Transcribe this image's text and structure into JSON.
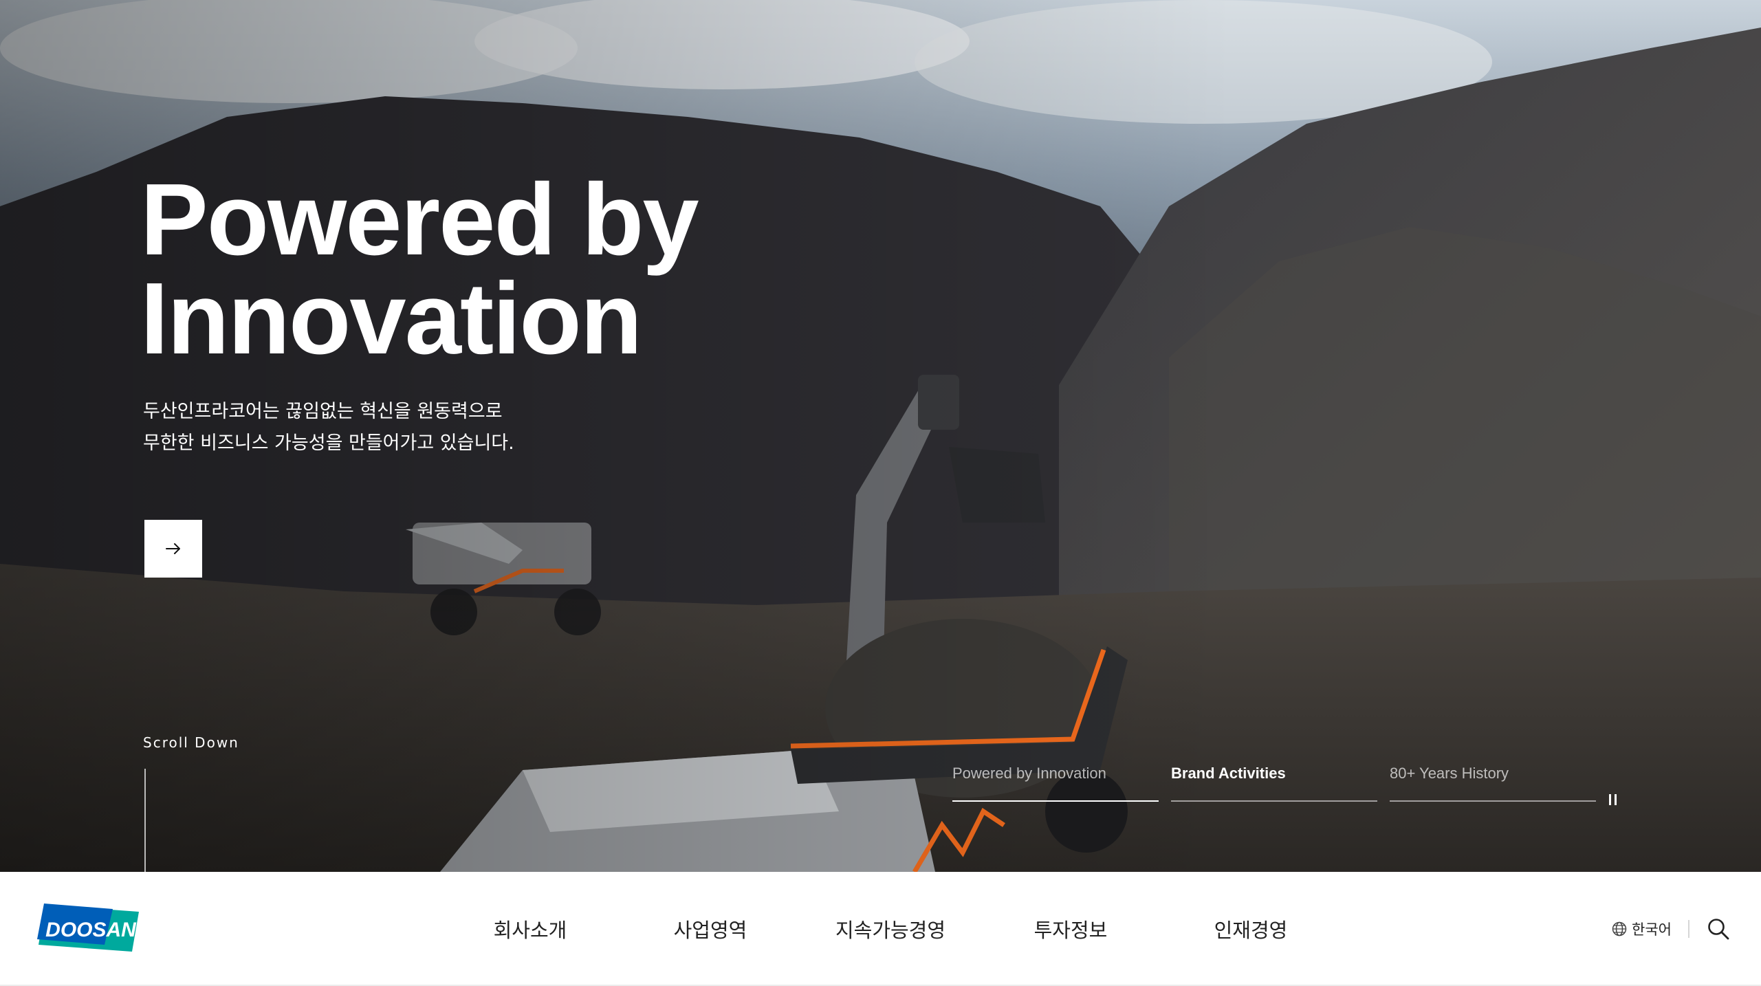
{
  "hero": {
    "title_line1": "Powered by",
    "title_line2": "Innovation",
    "desc_line1": "두산인프라코어는 끊임없는 혁신을 원동력으로",
    "desc_line2": "무한한 비즈니스 가능성을 만들어가고 있습니다.",
    "more_icon": "arrow-right-icon",
    "scroll_down": "Scroll Down",
    "accent_color": "#f26b1d"
  },
  "slides": {
    "tabs": [
      {
        "label": "Powered by Innovation",
        "progress": 1.0,
        "active": false
      },
      {
        "label": "Brand Activities",
        "progress": 0.0,
        "active": true
      },
      {
        "label": "80+ Years History",
        "progress": 0.0,
        "active": false
      }
    ],
    "pause_icon": "pause-icon"
  },
  "header": {
    "logo_text": "DOOSAN",
    "brand_colors": {
      "blue": "#005eb8",
      "teal": "#00a99d",
      "white": "#ffffff"
    },
    "nav": [
      {
        "label": "회사소개"
      },
      {
        "label": "사업영역"
      },
      {
        "label": "지속가능경영"
      },
      {
        "label": "투자정보"
      },
      {
        "label": "인재경영"
      }
    ],
    "language": "한국어",
    "globe_icon": "globe-icon",
    "search_icon": "search-icon"
  }
}
